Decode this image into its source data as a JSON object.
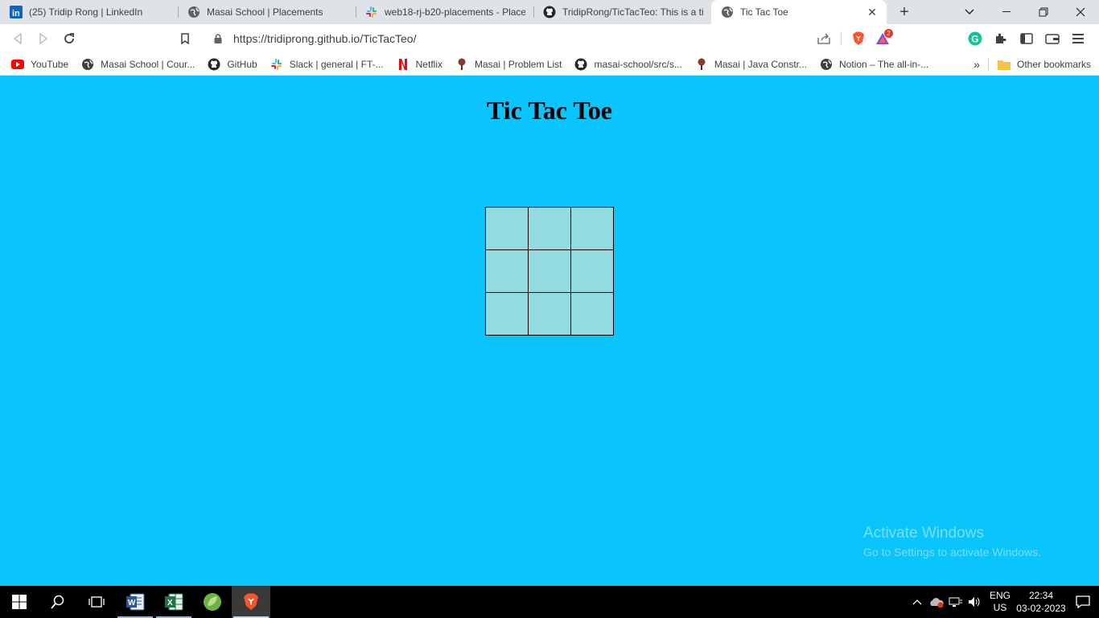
{
  "tabs": [
    {
      "title": "(25) Tridip Rong | LinkedIn",
      "icon": "linkedin-icon"
    },
    {
      "title": "Masai School | Placements",
      "icon": "globe-icon"
    },
    {
      "title": "web18-rj-b20-placements - Placem",
      "icon": "slack-icon"
    },
    {
      "title": "TridipRong/TicTacTeo: This is a tic t",
      "icon": "github-icon"
    },
    {
      "title": "Tic Tac Toe",
      "icon": "globe-icon",
      "active": true
    }
  ],
  "address_bar": {
    "url": "https://tridiprong.github.io/TicTacTeo/"
  },
  "brave_badge": "2",
  "bookmarks": [
    {
      "label": "YouTube",
      "icon": "youtube-icon"
    },
    {
      "label": "Masai School | Cour...",
      "icon": "globe-icon"
    },
    {
      "label": "GitHub",
      "icon": "github-icon"
    },
    {
      "label": "Slack | general | FT-...",
      "icon": "slack-icon"
    },
    {
      "label": "Netflix",
      "icon": "netflix-icon"
    },
    {
      "label": "Masai | Problem List",
      "icon": "masai-icon"
    },
    {
      "label": "masai-school/src/s...",
      "icon": "github-icon"
    },
    {
      "label": "Masai | Java Constr...",
      "icon": "masai-icon"
    },
    {
      "label": "Notion – The all-in-...",
      "icon": "globe-icon"
    }
  ],
  "other_bookmarks": "Other bookmarks",
  "page": {
    "heading": "Tic Tac Toe",
    "board": [
      "",
      "",
      "",
      "",
      "",
      "",
      "",
      "",
      ""
    ]
  },
  "watermark": {
    "line1": "Activate Windows",
    "line2": "Go to Settings to activate Windows."
  },
  "taskbar": {
    "lang_line1": "ENG",
    "lang_line2": "US",
    "time": "22:34",
    "date": "03-02-2023"
  },
  "colors": {
    "page_background": "#0ac4fc",
    "cell_fill": "#92dbe0"
  }
}
